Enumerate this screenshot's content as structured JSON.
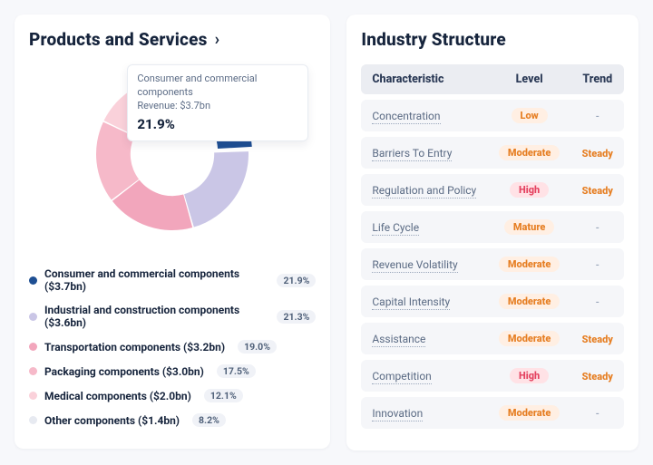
{
  "left": {
    "title": "Products and Services",
    "tooltip": {
      "line1": "Consumer and commercial components",
      "line2": "Revenue: $3.7bn",
      "pct": "21.9%"
    }
  },
  "right": {
    "title": "Industry Structure",
    "columns": {
      "c1": "Characteristic",
      "c2": "Level",
      "c3": "Trend"
    },
    "rows": [
      {
        "name": "Concentration",
        "level": "Low",
        "trend": "-"
      },
      {
        "name": "Barriers To Entry",
        "level": "Moderate",
        "trend": "Steady"
      },
      {
        "name": "Regulation and Policy",
        "level": "High",
        "trend": "Steady"
      },
      {
        "name": "Life Cycle",
        "level": "Mature",
        "trend": "-"
      },
      {
        "name": "Revenue Volatility",
        "level": "Moderate",
        "trend": "-"
      },
      {
        "name": "Capital Intensity",
        "level": "Moderate",
        "trend": "-"
      },
      {
        "name": "Assistance",
        "level": "Moderate",
        "trend": "Steady"
      },
      {
        "name": "Competition",
        "level": "High",
        "trend": "Steady"
      },
      {
        "name": "Innovation",
        "level": "Moderate",
        "trend": "-"
      }
    ]
  },
  "chart_data": {
    "type": "pie",
    "title": "Products and Services",
    "unit": "percent",
    "series": [
      {
        "name": "Consumer and commercial components",
        "revenue": "$3.7bn",
        "value": 21.9,
        "color": "#1e4f93"
      },
      {
        "name": "Industrial and construction components",
        "revenue": "$3.6bn",
        "value": 21.3,
        "color": "#cac6e6"
      },
      {
        "name": "Transportation components",
        "revenue": "$3.2bn",
        "value": 19.0,
        "color": "#f2a6bc"
      },
      {
        "name": "Packaging components",
        "revenue": "$3.0bn",
        "value": 17.5,
        "color": "#f6b9c9"
      },
      {
        "name": "Medical components",
        "revenue": "$2.0bn",
        "value": 12.1,
        "color": "#fad1da"
      },
      {
        "name": "Other components",
        "revenue": "$1.4bn",
        "value": 8.2,
        "color": "#e7eaf1"
      }
    ],
    "highlight_index": 0,
    "inner_ratio": 0.55
  }
}
